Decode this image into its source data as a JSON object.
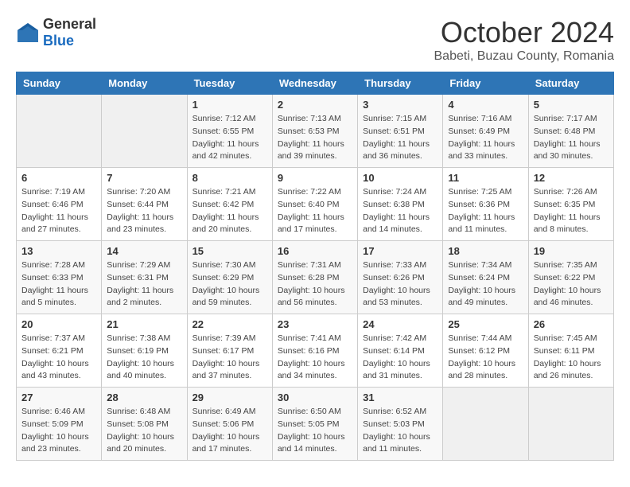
{
  "logo": {
    "general": "General",
    "blue": "Blue"
  },
  "header": {
    "month": "October 2024",
    "location": "Babeti, Buzau County, Romania"
  },
  "weekdays": [
    "Sunday",
    "Monday",
    "Tuesday",
    "Wednesday",
    "Thursday",
    "Friday",
    "Saturday"
  ],
  "weeks": [
    [
      {
        "day": "",
        "info": ""
      },
      {
        "day": "",
        "info": ""
      },
      {
        "day": "1",
        "info": "Sunrise: 7:12 AM\nSunset: 6:55 PM\nDaylight: 11 hours and 42 minutes."
      },
      {
        "day": "2",
        "info": "Sunrise: 7:13 AM\nSunset: 6:53 PM\nDaylight: 11 hours and 39 minutes."
      },
      {
        "day": "3",
        "info": "Sunrise: 7:15 AM\nSunset: 6:51 PM\nDaylight: 11 hours and 36 minutes."
      },
      {
        "day": "4",
        "info": "Sunrise: 7:16 AM\nSunset: 6:49 PM\nDaylight: 11 hours and 33 minutes."
      },
      {
        "day": "5",
        "info": "Sunrise: 7:17 AM\nSunset: 6:48 PM\nDaylight: 11 hours and 30 minutes."
      }
    ],
    [
      {
        "day": "6",
        "info": "Sunrise: 7:19 AM\nSunset: 6:46 PM\nDaylight: 11 hours and 27 minutes."
      },
      {
        "day": "7",
        "info": "Sunrise: 7:20 AM\nSunset: 6:44 PM\nDaylight: 11 hours and 23 minutes."
      },
      {
        "day": "8",
        "info": "Sunrise: 7:21 AM\nSunset: 6:42 PM\nDaylight: 11 hours and 20 minutes."
      },
      {
        "day": "9",
        "info": "Sunrise: 7:22 AM\nSunset: 6:40 PM\nDaylight: 11 hours and 17 minutes."
      },
      {
        "day": "10",
        "info": "Sunrise: 7:24 AM\nSunset: 6:38 PM\nDaylight: 11 hours and 14 minutes."
      },
      {
        "day": "11",
        "info": "Sunrise: 7:25 AM\nSunset: 6:36 PM\nDaylight: 11 hours and 11 minutes."
      },
      {
        "day": "12",
        "info": "Sunrise: 7:26 AM\nSunset: 6:35 PM\nDaylight: 11 hours and 8 minutes."
      }
    ],
    [
      {
        "day": "13",
        "info": "Sunrise: 7:28 AM\nSunset: 6:33 PM\nDaylight: 11 hours and 5 minutes."
      },
      {
        "day": "14",
        "info": "Sunrise: 7:29 AM\nSunset: 6:31 PM\nDaylight: 11 hours and 2 minutes."
      },
      {
        "day": "15",
        "info": "Sunrise: 7:30 AM\nSunset: 6:29 PM\nDaylight: 10 hours and 59 minutes."
      },
      {
        "day": "16",
        "info": "Sunrise: 7:31 AM\nSunset: 6:28 PM\nDaylight: 10 hours and 56 minutes."
      },
      {
        "day": "17",
        "info": "Sunrise: 7:33 AM\nSunset: 6:26 PM\nDaylight: 10 hours and 53 minutes."
      },
      {
        "day": "18",
        "info": "Sunrise: 7:34 AM\nSunset: 6:24 PM\nDaylight: 10 hours and 49 minutes."
      },
      {
        "day": "19",
        "info": "Sunrise: 7:35 AM\nSunset: 6:22 PM\nDaylight: 10 hours and 46 minutes."
      }
    ],
    [
      {
        "day": "20",
        "info": "Sunrise: 7:37 AM\nSunset: 6:21 PM\nDaylight: 10 hours and 43 minutes."
      },
      {
        "day": "21",
        "info": "Sunrise: 7:38 AM\nSunset: 6:19 PM\nDaylight: 10 hours and 40 minutes."
      },
      {
        "day": "22",
        "info": "Sunrise: 7:39 AM\nSunset: 6:17 PM\nDaylight: 10 hours and 37 minutes."
      },
      {
        "day": "23",
        "info": "Sunrise: 7:41 AM\nSunset: 6:16 PM\nDaylight: 10 hours and 34 minutes."
      },
      {
        "day": "24",
        "info": "Sunrise: 7:42 AM\nSunset: 6:14 PM\nDaylight: 10 hours and 31 minutes."
      },
      {
        "day": "25",
        "info": "Sunrise: 7:44 AM\nSunset: 6:12 PM\nDaylight: 10 hours and 28 minutes."
      },
      {
        "day": "26",
        "info": "Sunrise: 7:45 AM\nSunset: 6:11 PM\nDaylight: 10 hours and 26 minutes."
      }
    ],
    [
      {
        "day": "27",
        "info": "Sunrise: 6:46 AM\nSunset: 5:09 PM\nDaylight: 10 hours and 23 minutes."
      },
      {
        "day": "28",
        "info": "Sunrise: 6:48 AM\nSunset: 5:08 PM\nDaylight: 10 hours and 20 minutes."
      },
      {
        "day": "29",
        "info": "Sunrise: 6:49 AM\nSunset: 5:06 PM\nDaylight: 10 hours and 17 minutes."
      },
      {
        "day": "30",
        "info": "Sunrise: 6:50 AM\nSunset: 5:05 PM\nDaylight: 10 hours and 14 minutes."
      },
      {
        "day": "31",
        "info": "Sunrise: 6:52 AM\nSunset: 5:03 PM\nDaylight: 10 hours and 11 minutes."
      },
      {
        "day": "",
        "info": ""
      },
      {
        "day": "",
        "info": ""
      }
    ]
  ]
}
